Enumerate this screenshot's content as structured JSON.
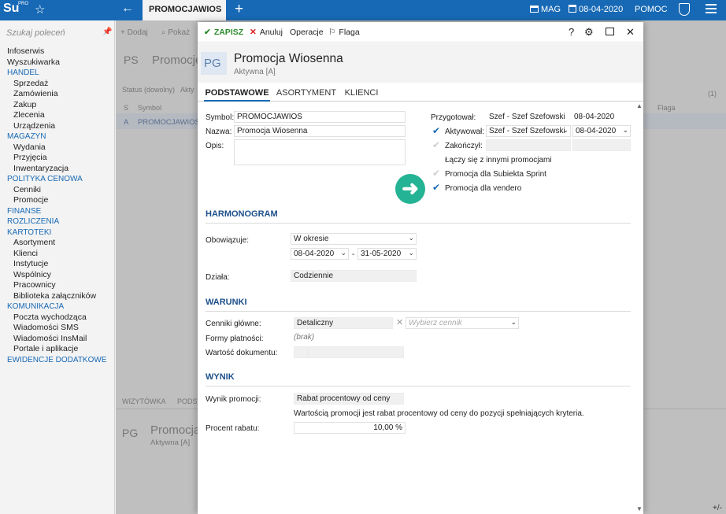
{
  "app": {
    "logo": "Su",
    "logo_badge": "PRO",
    "active_tab": "PROMOCJAWIOS",
    "warehouse": "MAG",
    "date": "08-04-2020",
    "help": "POMOC"
  },
  "sidebar": {
    "search_placeholder": "Szukaj poleceń",
    "items": [
      {
        "label": "Infoserwis",
        "kind": "top"
      },
      {
        "label": "Wyszukiwarka",
        "kind": "top"
      },
      {
        "label": "HANDEL",
        "kind": "sec"
      },
      {
        "label": "Sprzedaż",
        "kind": "sub"
      },
      {
        "label": "Zamówienia",
        "kind": "sub"
      },
      {
        "label": "Zakup",
        "kind": "sub"
      },
      {
        "label": "Zlecenia",
        "kind": "sub"
      },
      {
        "label": "Urządzenia",
        "kind": "sub"
      },
      {
        "label": "MAGAZYN",
        "kind": "sec"
      },
      {
        "label": "Wydania",
        "kind": "sub"
      },
      {
        "label": "Przyjęcia",
        "kind": "sub"
      },
      {
        "label": "Inwentaryzacja",
        "kind": "sub"
      },
      {
        "label": "POLITYKA CENOWA",
        "kind": "sec"
      },
      {
        "label": "Cenniki",
        "kind": "sub"
      },
      {
        "label": "Promocje",
        "kind": "sub"
      },
      {
        "label": "FINANSE",
        "kind": "sec"
      },
      {
        "label": "ROZLICZENIA",
        "kind": "sec"
      },
      {
        "label": "KARTOTEKI",
        "kind": "sec"
      },
      {
        "label": "Asortyment",
        "kind": "sub"
      },
      {
        "label": "Klienci",
        "kind": "sub"
      },
      {
        "label": "Instytucje",
        "kind": "sub"
      },
      {
        "label": "Wspólnicy",
        "kind": "sub"
      },
      {
        "label": "Pracownicy",
        "kind": "sub"
      },
      {
        "label": "Biblioteka załączników",
        "kind": "sub"
      },
      {
        "label": "KOMUNIKACJA",
        "kind": "sec"
      },
      {
        "label": "Poczta wychodząca",
        "kind": "sub"
      },
      {
        "label": "Wiadomości SMS",
        "kind": "sub"
      },
      {
        "label": "Wiadomości InsMail",
        "kind": "sub"
      },
      {
        "label": "Portale i aplikacje",
        "kind": "sub"
      },
      {
        "label": "EWIDENCJE DODATKOWE",
        "kind": "sec"
      }
    ]
  },
  "background": {
    "add": "Dodaj",
    "show": "Pokaż",
    "ps": "PS",
    "title": "Promocje",
    "status": "Status (dowolny)",
    "status2": "Akty",
    "col_s": "S",
    "col_symbol": "Symbol",
    "col_flag": "Flaga",
    "count": "(1)",
    "row_status": "A",
    "row_symbol": "PROMOCJAWIOS",
    "tab_card": "WIZYTÓWKA",
    "tab_basic": "PODST",
    "pg": "PG",
    "card_title": "Promocja",
    "card_sub": "Aktywna [A]"
  },
  "dialog": {
    "toolbar": {
      "save": "ZAPISZ",
      "cancel": "Anuluj",
      "operations": "Operacje",
      "flag": "Flaga",
      "help": "?"
    },
    "badge": "PG",
    "title": "Promocja Wiosenna",
    "subtitle": "Aktywna [A]",
    "tabs": [
      "PODSTAWOWE",
      "ASORTYMENT",
      "KLIENCI"
    ],
    "basic": {
      "symbol_label": "Symbol:",
      "symbol": "PROMOCJAWIOS",
      "name_label": "Nazwa:",
      "name": "Promocja Wiosenna",
      "desc_label": "Opis:",
      "desc": "",
      "prepared_label": "Przygotował:",
      "prepared_by": "Szef - Szef Szefowski",
      "prepared_date": "08-04-2020",
      "activated_label": "Aktywował:",
      "activated_by": "Szef - Szef Szefowski",
      "activated_date": "08-04-2020",
      "finished_label": "Zakończył:",
      "combine_label": "Łączy się z innymi promocjami",
      "sprint_label": "Promocja dla Subiekta Sprint",
      "vendero_label": "Promocja dla vendero"
    },
    "schedule": {
      "title": "HARMONOGRAM",
      "valid_label": "Obowiązuje:",
      "valid": "W okresie",
      "from": "08-04-2020",
      "dash": "-",
      "to": "31-05-2020",
      "works_label": "Działa:",
      "works": "Codziennie"
    },
    "conditions": {
      "title": "WARUNKI",
      "price_lists_label": "Cenniki główne:",
      "price_list": "Detaliczny",
      "price_list_placeholder": "Wybierz cennik",
      "payment_label": "Formy płatności:",
      "payment": "(brak)",
      "doc_value_label": "Wartość dokumentu:"
    },
    "result": {
      "title": "WYNIK",
      "result_label": "Wynik promocji:",
      "result": "Rabat procentowy od ceny",
      "description": "Wartością promocji jest rabat procentowy od ceny do pozycji spełniających kryteria.",
      "discount_label": "Procent rabatu:",
      "discount": "10,00 %"
    }
  },
  "status_bar": {
    "pm": "+/-"
  },
  "colors": {
    "accent": "#1769b5",
    "highlight": "#24b394",
    "save": "#2e8b2e",
    "cancel": "#dd2222"
  }
}
